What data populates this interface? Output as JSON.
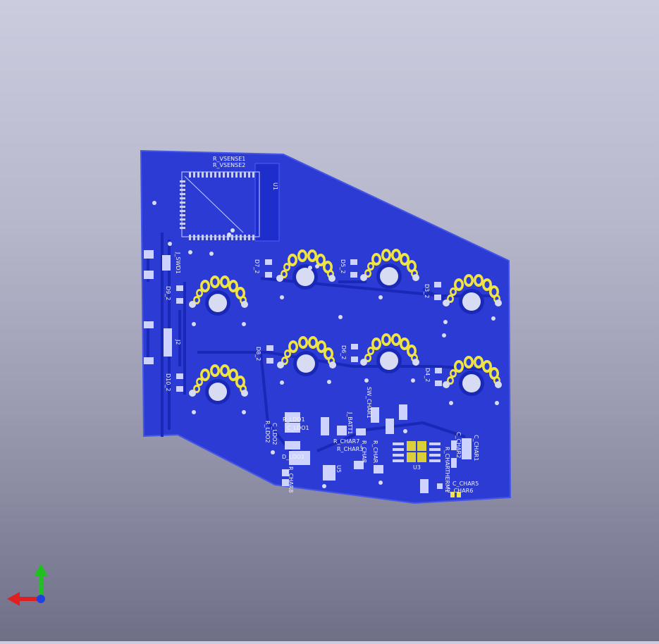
{
  "viewer": {
    "background_top": "#ccccdf",
    "background_bottom": "#6f6f88",
    "board_color": "#2b3bd4",
    "copper_color": "#1a28b8",
    "pad_color": "#f0e442",
    "silkscreen_color": "#f2f2f2"
  },
  "board": {
    "labels": {
      "r_vsense1": "R_VSENSE1",
      "r_vsense2": "R_VSENSE2",
      "u1": "U1",
      "j_swd1": "J_SWD1",
      "j2": "J2",
      "d9_2": "D9_2",
      "d10_2": "D10_2",
      "d7_2": "D7_2",
      "d5_2": "D5_2",
      "d3_2": "D3_2",
      "d8_2": "D8_2",
      "d6_2": "D6_2",
      "d4_2": "D4_2",
      "sw_char1": "SW_CHAR1",
      "r_ldo1": "R_LDO1",
      "c_ldo1": "C_LDO1",
      "r_ldo2": "R_LDO2",
      "c_ldo2": "C_LDO2",
      "d_ldo1": "D_LDO1",
      "r_char8": "R_CHAR8",
      "j_batt1": "J_BATT1",
      "r_char7": "R_CHAR7",
      "r_char3": "R_CHAR3",
      "u5": "U5",
      "r_char": "R_CHAR",
      "r_char_b": "R_CHAR",
      "u3": "U3",
      "c_char1": "C_CHAR1",
      "c_char2": "C_CHAR2",
      "r_char_therm": "R_CHARTHERM1",
      "c_char5": "C_CHAR5",
      "c_char6": "C_CHAR6"
    }
  },
  "axes_gizmo": {
    "x_color": "#e02020",
    "y_color": "#20c020",
    "z_color": "#2040e0"
  }
}
